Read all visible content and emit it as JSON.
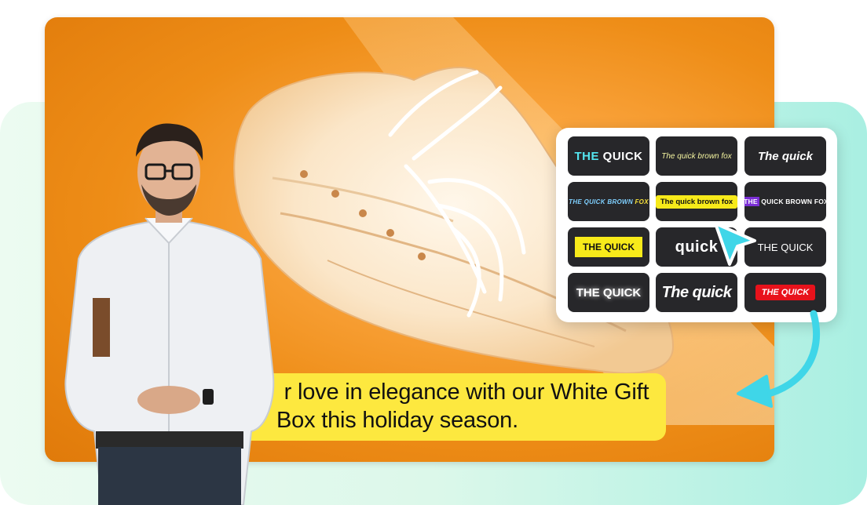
{
  "caption": {
    "line1": "r love in elegance with our White Gift",
    "line2": "Box this holiday season."
  },
  "caption_styles": [
    {
      "name": "the-quick-cyan",
      "pre": "THE",
      "text": " QUICK"
    },
    {
      "name": "quick-brown-fox-serif",
      "text": "The quick brown fox"
    },
    {
      "name": "the-quick-bold-italic",
      "text": "The quick"
    },
    {
      "name": "quick-brown-fox-caps",
      "text": "THE QUICK BROWN ",
      "hl": "FOX"
    },
    {
      "name": "quick-brown-fox-yellow",
      "text": "The quick brown fox"
    },
    {
      "name": "quick-brown-fox-purple",
      "pre": "THE",
      "text": " QUICK BROWN FOX"
    },
    {
      "name": "the-quick-yellow-box",
      "text": "THE QUICK"
    },
    {
      "name": "quick-big",
      "text": "quick"
    },
    {
      "name": "the-quick-plain",
      "text": "THE QUICK"
    },
    {
      "name": "the-quick-glow",
      "text": "THE QUICK"
    },
    {
      "name": "the-quick-big-italic",
      "text": "The quick"
    },
    {
      "name": "the-quick-red",
      "text": "THE QUICK"
    }
  ],
  "colors": {
    "accent_cyan": "#3fd6e8",
    "caption_yellow": "#fde83f",
    "video_orange": "#ee8d17",
    "tile_dark": "#27272a"
  },
  "icons": [
    "cursor-pointer-icon",
    "curved-arrow-icon"
  ]
}
